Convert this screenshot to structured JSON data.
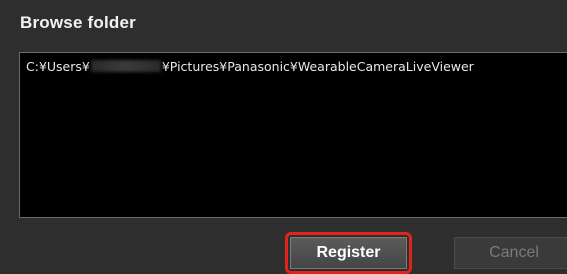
{
  "dialog": {
    "title": "Browse folder"
  },
  "path": {
    "prefix": "C:¥Users¥",
    "suffix": "¥Pictures¥Panasonic¥WearableCameraLiveViewer"
  },
  "buttons": {
    "register_label": "Register",
    "cancel_label": "Cancel"
  },
  "colors": {
    "dialog_bg": "#2e2e2e",
    "path_bg": "#000000",
    "highlight": "#e0241c"
  }
}
